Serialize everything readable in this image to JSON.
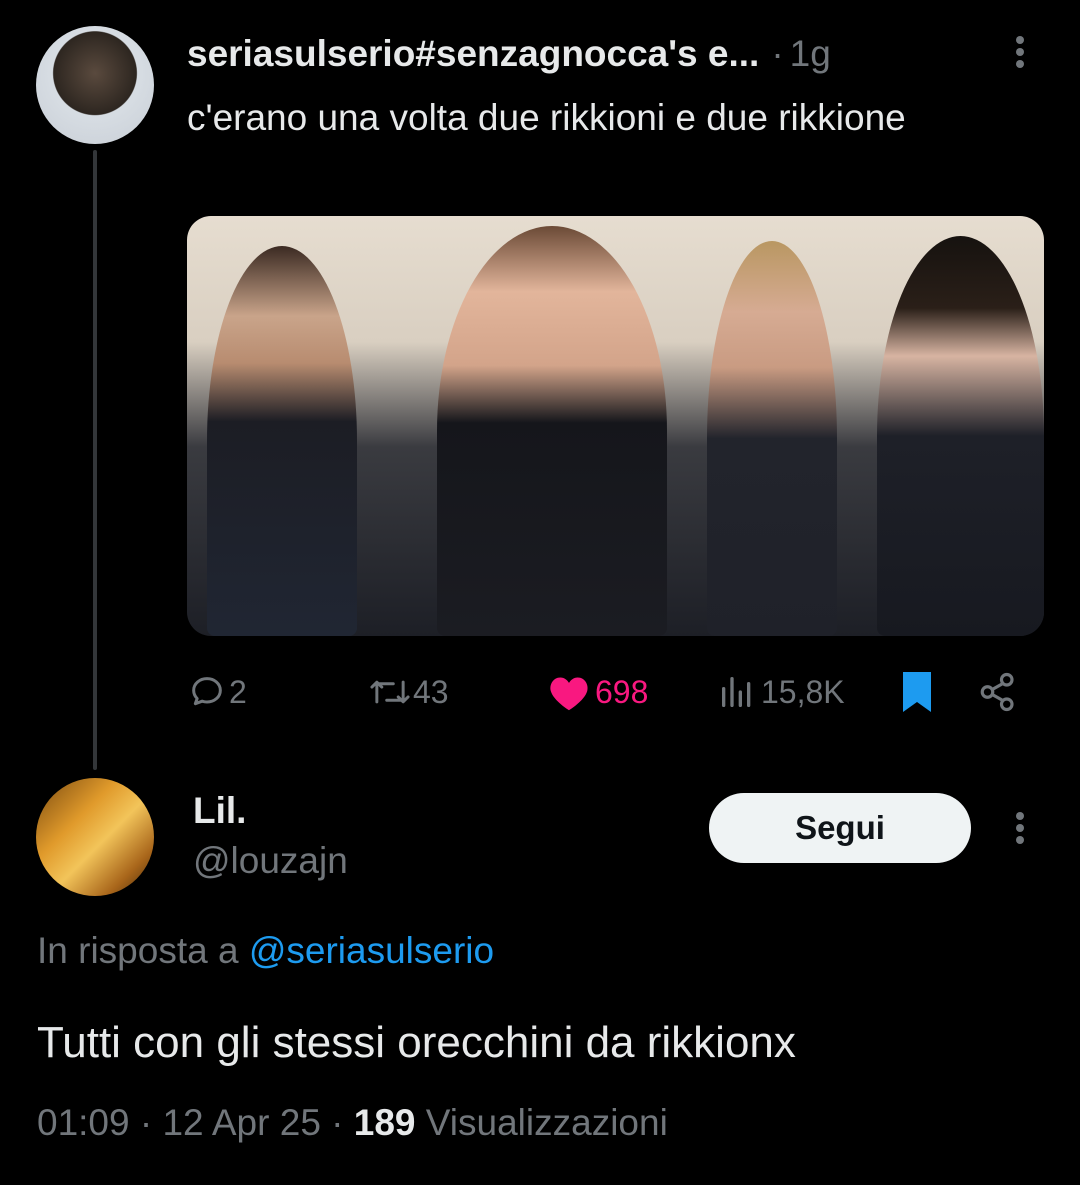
{
  "original_tweet": {
    "author_name": "seriasulserio#senzagnocca's e...",
    "meta_separator": "·",
    "timestamp": "1g",
    "text": "c'erano una volta due rikkioni e due rikkione",
    "media_icon": "photo",
    "actions": {
      "replies": "2",
      "retweets": "43",
      "likes": "698",
      "views": "15,8K"
    },
    "colors": {
      "like": "#f91880",
      "bookmark": "#1d9bf0"
    }
  },
  "reply": {
    "author_name": "Lil.",
    "handle": "@louzajn",
    "follow_label": "Segui",
    "in_reply_to_prefix": "In risposta a",
    "in_reply_to_mention": "@seriasulserio",
    "text": "Tutti con gli stessi orecchini da rikkionx",
    "time": "01:09",
    "date": "12 Apr 25",
    "sep": "·",
    "views_count": "189",
    "views_label": "Visualizzazioni"
  },
  "colors": {
    "background": "#000000",
    "text": "#e7e9ea",
    "muted": "#71767b",
    "accent": "#1d9bf0"
  }
}
